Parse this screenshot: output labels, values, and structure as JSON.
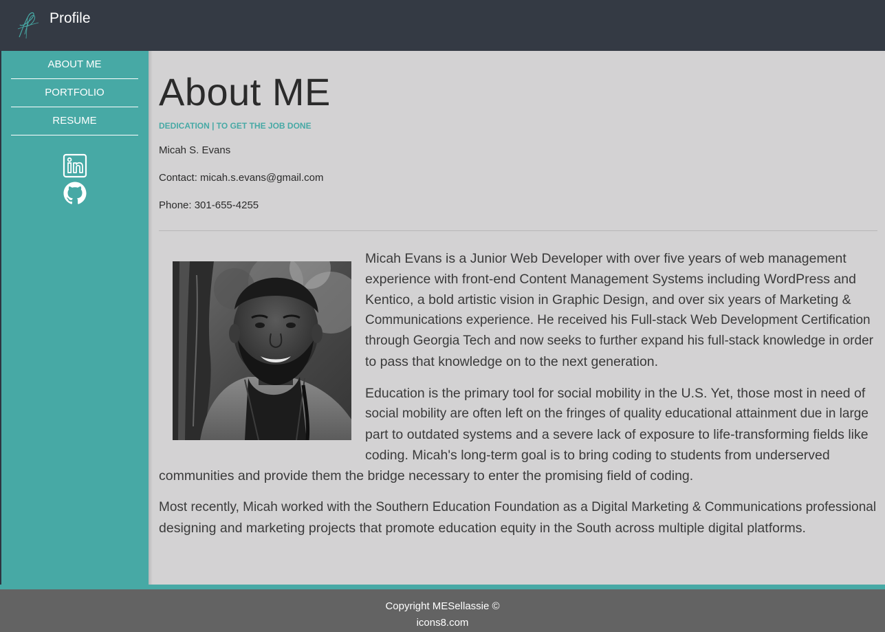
{
  "header": {
    "logo_icon": "signature-logo-icon",
    "brand": "Profile"
  },
  "sidebar": {
    "items": [
      {
        "label": "ABOUT ME"
      },
      {
        "label": "PORTFOLIO"
      },
      {
        "label": "RESUME"
      }
    ],
    "social": [
      {
        "icon": "linkedin-icon"
      },
      {
        "icon": "github-icon"
      }
    ]
  },
  "main": {
    "title": "About ME",
    "tagline": "DEDICATION | TO GET THE JOB DONE",
    "name": "Micah S. Evans",
    "contact": "Contact: micah.s.evans@gmail.com",
    "phone": "Phone: 301-655-4255",
    "bio": {
      "p1_lines": [
        "Micah Evans is a Junior Web Developer with over five years of web management",
        "experience with front-end Content Management Systems including WordPress and",
        "Kentico, a bold artistic vision in Graphic Design, and over six years of Marketing &",
        "Communications experience. He received his Full-stack Web Development Certification",
        "through Georgia Tech and now seeks to further expand his full-stack knowledge in order",
        "to pass that knowledge on to the next generation."
      ],
      "p2_lines": [
        "Education is the primary tool for social mobility in the U.S. Yet, those most in need of",
        "social mobility are often left on the fringes of quality educational attainment due in large",
        "part to outdated systems and a severe lack of exposure to life-transforming fields like",
        "coding. Micah's long-term goal is to bring coding to students from underserved",
        "communities and provide them the bridge necessary to enter the promising field of coding."
      ],
      "p3_lines": [
        "Most recently, Micah worked with the Southern Education Foundation as a Digital Marketing & Communications professional",
        "designing and marketing projects that promote education equity in the South across multiple digital platforms."
      ]
    }
  },
  "footer": {
    "copyright": "Copyright MESellassie ©",
    "credit": "icons8.com"
  },
  "colors": {
    "accent": "#47a9a5",
    "header": "#343a44",
    "content_bg": "#d3d2d3",
    "footer": "#636363"
  }
}
